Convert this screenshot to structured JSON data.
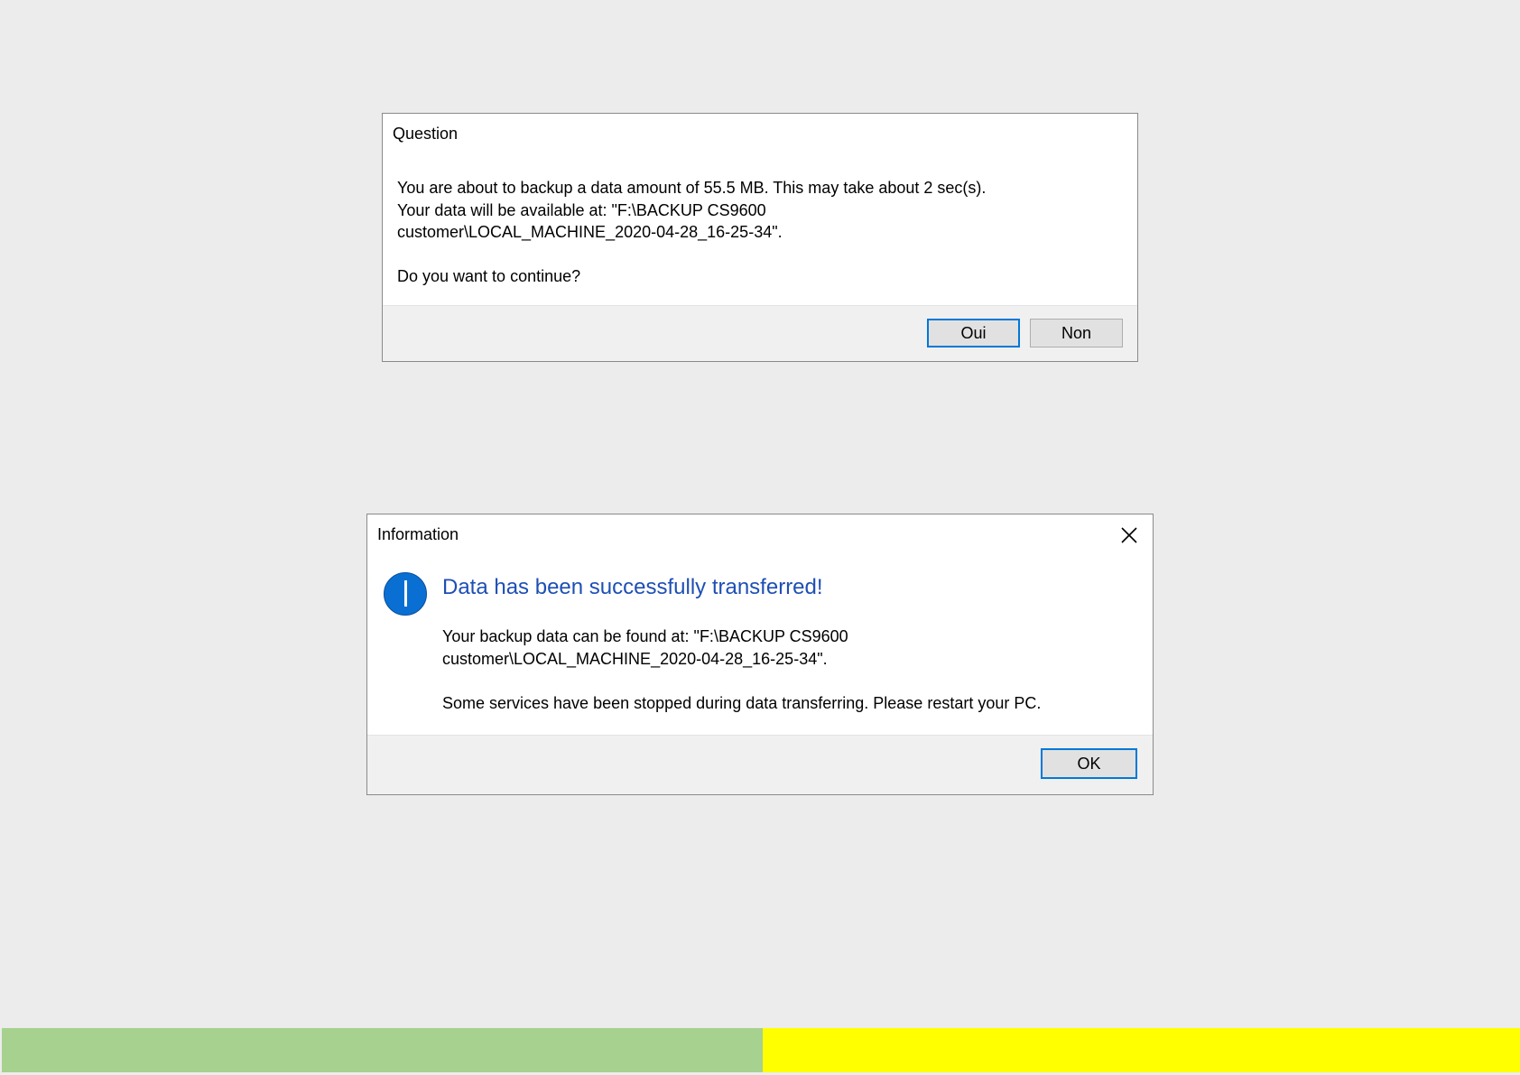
{
  "question_dialog": {
    "title": "Question",
    "lines": [
      "You are about to backup a data amount of 55.5 MB. This may take about 2 sec(s).",
      "Your data will be available at: \"F:\\BACKUP CS9600",
      "customer\\LOCAL_MACHINE_2020-04-28_16-25-34\".",
      "",
      "Do you want to continue?"
    ],
    "yes_label": "Oui",
    "no_label": "Non"
  },
  "info_dialog": {
    "title": "Information",
    "close_icon": "close-icon",
    "icon": "info-icon",
    "heading": "Data has been successfully transferred!",
    "lines": [
      "Your backup data can be found at: \"F:\\BACKUP CS9600",
      "customer\\LOCAL_MACHINE_2020-04-28_16-25-34\".",
      "",
      "Some services have been stopped during data transferring. Please restart your PC."
    ],
    "ok_label": "OK"
  },
  "colors": {
    "accent": "#0078d7",
    "heading": "#1e4fb5",
    "info_icon": "#0a6fd3",
    "green_bar": "#a6d18f",
    "yellow_bar": "#ffff00"
  }
}
